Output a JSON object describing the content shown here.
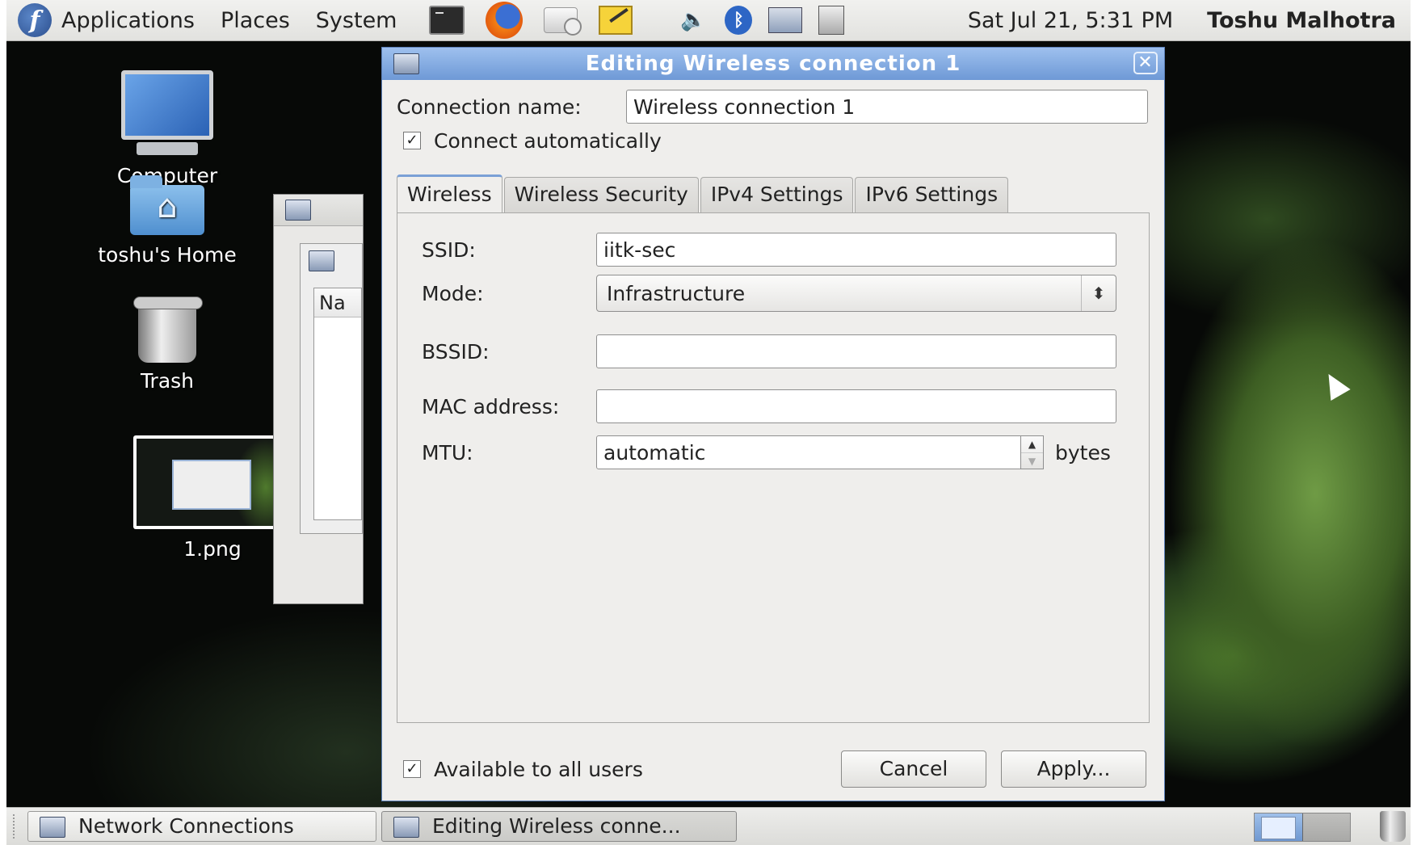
{
  "top_panel": {
    "menus": [
      "Applications",
      "Places",
      "System"
    ],
    "clock": "Sat Jul 21,  5:31 PM",
    "user": "Toshu Malhotra",
    "logo_glyph": "f",
    "launcher_icons": [
      "terminal-icon",
      "firefox-icon",
      "mail-icon",
      "notes-icon"
    ],
    "applet_icons": [
      "volume-icon",
      "bluetooth-icon",
      "network-icon",
      "power-icon"
    ]
  },
  "desktop": {
    "icons": [
      {
        "label": "Computer",
        "icon": "computer-icon"
      },
      {
        "label": "toshu's Home",
        "icon": "home-folder-icon"
      },
      {
        "label": "Trash",
        "icon": "trash-icon"
      },
      {
        "label": "1.png",
        "icon": "image-file-icon"
      }
    ],
    "background_window_column": "Na"
  },
  "dialog": {
    "title": "Editing Wireless connection 1",
    "connection_name_label": "Connection name:",
    "connection_name_value": "Wireless connection 1",
    "connect_automatically_label": "Connect automatically",
    "connect_automatically_checked": true,
    "tabs": [
      "Wireless",
      "Wireless Security",
      "IPv4 Settings",
      "IPv6 Settings"
    ],
    "active_tab": "Wireless",
    "wireless": {
      "ssid_label": "SSID:",
      "ssid_value": "iitk-sec",
      "mode_label": "Mode:",
      "mode_value": "Infrastructure",
      "bssid_label": "BSSID:",
      "bssid_value": "",
      "mac_label": "MAC address:",
      "mac_value": "",
      "mtu_label": "MTU:",
      "mtu_value": "automatic",
      "mtu_unit": "bytes"
    },
    "available_all_users_label": "Available to all users",
    "available_all_users_checked": true,
    "cancel_label": "Cancel",
    "apply_label": "Apply..."
  },
  "bottom_panel": {
    "tasks": [
      "Network Connections",
      "Editing Wireless conne..."
    ]
  },
  "colors": {
    "titlebar": "#7ea6de",
    "accent": "#5b7fb7"
  }
}
